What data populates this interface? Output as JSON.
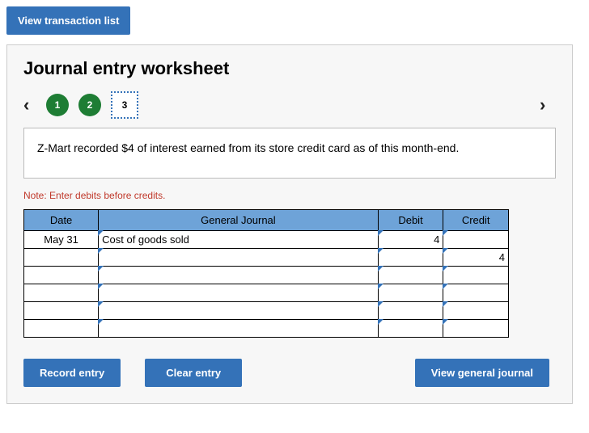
{
  "top_button": "View transaction list",
  "title": "Journal entry worksheet",
  "nav": {
    "prev_glyph": "‹",
    "next_glyph": "›",
    "steps": [
      "1",
      "2",
      "3"
    ],
    "current_index": 2
  },
  "prompt": "Z-Mart recorded $4 of interest earned from its store credit card as of this month-end.",
  "note": "Note: Enter debits before credits.",
  "table": {
    "headers": {
      "date": "Date",
      "gj": "General Journal",
      "debit": "Debit",
      "credit": "Credit"
    },
    "rows": [
      {
        "date": "May 31",
        "gj": "Cost of goods sold",
        "debit": "4",
        "credit": ""
      },
      {
        "date": "",
        "gj": "",
        "debit": "",
        "credit": "4"
      },
      {
        "date": "",
        "gj": "",
        "debit": "",
        "credit": ""
      },
      {
        "date": "",
        "gj": "",
        "debit": "",
        "credit": ""
      },
      {
        "date": "",
        "gj": "",
        "debit": "",
        "credit": ""
      },
      {
        "date": "",
        "gj": "",
        "debit": "",
        "credit": ""
      }
    ]
  },
  "buttons": {
    "record": "Record entry",
    "clear": "Clear entry",
    "view_gj": "View general journal"
  }
}
